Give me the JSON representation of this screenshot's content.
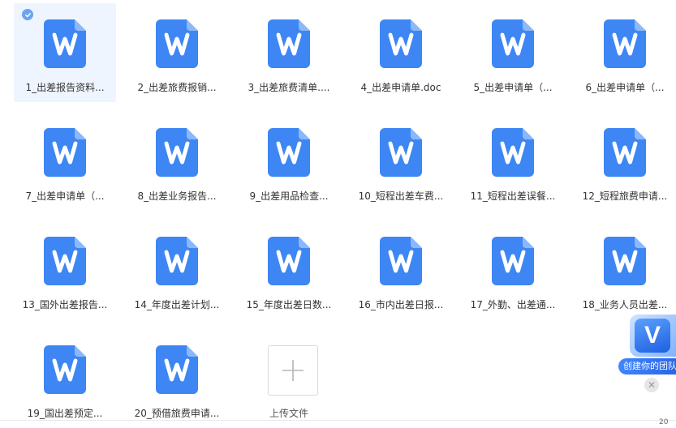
{
  "files": [
    {
      "name": "1_出差报告资料...",
      "selected": true
    },
    {
      "name": "2_出差旅费报销..."
    },
    {
      "name": "3_出差旅费清单...."
    },
    {
      "name": "4_出差申请单.doc"
    },
    {
      "name": "5_出差申请单（..."
    },
    {
      "name": "6_出差申请单（..."
    },
    {
      "name": "7_出差申请单（..."
    },
    {
      "name": "8_出差业务报告..."
    },
    {
      "name": "9_出差用品检查..."
    },
    {
      "name": "10_短程出差车费..."
    },
    {
      "name": "11_短程出差误餐..."
    },
    {
      "name": "12_短程旅费申请..."
    },
    {
      "name": "13_国外出差报告..."
    },
    {
      "name": "14_年度出差计划..."
    },
    {
      "name": "15_年度出差日数..."
    },
    {
      "name": "16_市内出差日报..."
    },
    {
      "name": "17_外勤、出差通..."
    },
    {
      "name": "18_业务人员出差..."
    },
    {
      "name": "19_国出差预定..."
    },
    {
      "name": "20_预借旅费申请..."
    }
  ],
  "upload": {
    "label": "上传文件"
  },
  "promo": {
    "text": "创建你的团队",
    "logo_letter": "V"
  },
  "corner_text": "20",
  "colors": {
    "doc_icon": "#3d86f4",
    "doc_fold": "#8bb8fa",
    "accent": "#2a66e6"
  }
}
